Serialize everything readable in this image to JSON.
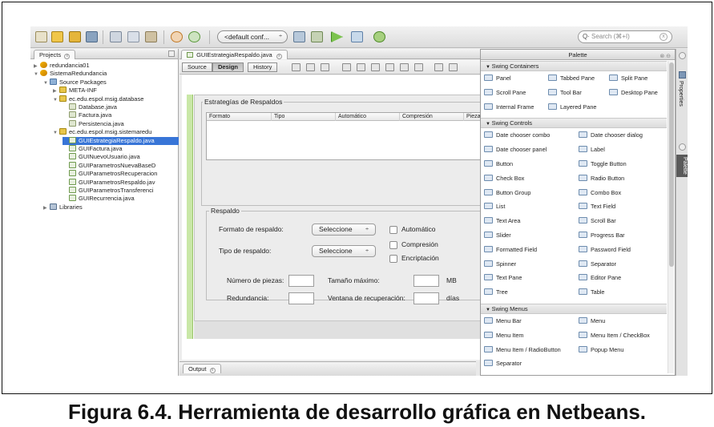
{
  "toolbar": {
    "config_combo": "<default conf...",
    "search_placeholder": "Search (⌘+I)"
  },
  "projects": {
    "tab_label": "Projects",
    "tree": [
      {
        "label": "redundancia01",
        "indent": 0,
        "twisty": "▶",
        "icon": "project"
      },
      {
        "label": "SistemaRedundancia",
        "indent": 0,
        "twisty": "▼",
        "icon": "project"
      },
      {
        "label": "Source Packages",
        "indent": 1,
        "twisty": "▼",
        "icon": "src"
      },
      {
        "label": "META-INF",
        "indent": 2,
        "twisty": "▶",
        "icon": "pkg"
      },
      {
        "label": "ec.edu.espol.msig.database",
        "indent": 2,
        "twisty": "▼",
        "icon": "pkg"
      },
      {
        "label": "Database.java",
        "indent": 3,
        "twisty": "",
        "icon": "java"
      },
      {
        "label": "Factura.java",
        "indent": 3,
        "twisty": "",
        "icon": "java"
      },
      {
        "label": "Persistencia.java",
        "indent": 3,
        "twisty": "",
        "icon": "java"
      },
      {
        "label": "ec.edu.espol.msig.sistemaredu",
        "indent": 2,
        "twisty": "▼",
        "icon": "pkg"
      },
      {
        "label": "GUIEstrategiaRespaldo.java",
        "indent": 3,
        "twisty": "",
        "icon": "form",
        "selected": true
      },
      {
        "label": "GUIFactura.java",
        "indent": 3,
        "twisty": "",
        "icon": "form"
      },
      {
        "label": "GUINuevoUsuario.java",
        "indent": 3,
        "twisty": "",
        "icon": "form"
      },
      {
        "label": "GUIParametrosNuevaBaseD",
        "indent": 3,
        "twisty": "",
        "icon": "form"
      },
      {
        "label": "GUIParametrosRecuperacion",
        "indent": 3,
        "twisty": "",
        "icon": "form"
      },
      {
        "label": "GUIParametrosRespaldo.jav",
        "indent": 3,
        "twisty": "",
        "icon": "form"
      },
      {
        "label": "GUIParametrosTransferenci",
        "indent": 3,
        "twisty": "",
        "icon": "form"
      },
      {
        "label": "GUIRecurrencia.java",
        "indent": 3,
        "twisty": "",
        "icon": "form"
      },
      {
        "label": "Libraries",
        "indent": 1,
        "twisty": "▶",
        "icon": "lib"
      }
    ]
  },
  "editor": {
    "tab_label": "GUIEstrategiaRespaldo.java",
    "view_source": "Source",
    "view_design": "Design",
    "view_history": "History"
  },
  "form": {
    "group1_title": "Estrategías de Respaldos",
    "table_headers": [
      "Formato",
      "Tipo",
      "Automático",
      "Compresión",
      "Pieza"
    ],
    "group2_title": "Respaldo",
    "formato_label": "Formato de respaldo:",
    "formato_value": "Seleccione",
    "tipo_label": "Tipo de respaldo:",
    "tipo_value": "Seleccione",
    "chk_automatico": "Automático",
    "chk_compresion": "Compresión",
    "chk_encriptacion": "Encriptación",
    "piezas_label": "Número de piezas:",
    "tamano_label": "Tamaño máximo:",
    "tamano_unit": "MB",
    "redundancia_label": "Redundancia:",
    "ventana_label": "Ventana de recuperación:",
    "ventana_unit": "días"
  },
  "output": {
    "tab_label": "Output"
  },
  "palette": {
    "title": "Palette",
    "categories": [
      {
        "label": "Swing Containers",
        "items": [
          "Panel",
          "Tabbed Pane",
          "Split Pane",
          "Scroll Pane",
          "Tool Bar",
          "Desktop Pane",
          "Internal Frame",
          "Layered Pane"
        ]
      },
      {
        "label": "Swing Controls",
        "items": [
          "Date chooser combo",
          "Date chooser dialog",
          "Date chooser panel",
          "Label",
          "Button",
          "Toggle Button",
          "Check Box",
          "Radio Button",
          "Button Group",
          "Combo Box",
          "List",
          "Text Field",
          "Text Area",
          "Scroll Bar",
          "Slider",
          "Progress Bar",
          "Formatted Field",
          "Password Field",
          "Spinner",
          "Separator",
          "Text Pane",
          "Editor Pane",
          "Tree",
          "Table"
        ]
      },
      {
        "label": "Swing Menus",
        "items": [
          "Menu Bar",
          "Menu",
          "Menu Item",
          "Menu Item / CheckBox",
          "Menu Item / RadioButton",
          "Popup Menu",
          "Separator"
        ]
      }
    ]
  },
  "side": {
    "properties": "Properties",
    "palette": "Palette"
  },
  "caption": "Figura 6.4. Herramienta de desarrollo gráfica en Netbeans."
}
